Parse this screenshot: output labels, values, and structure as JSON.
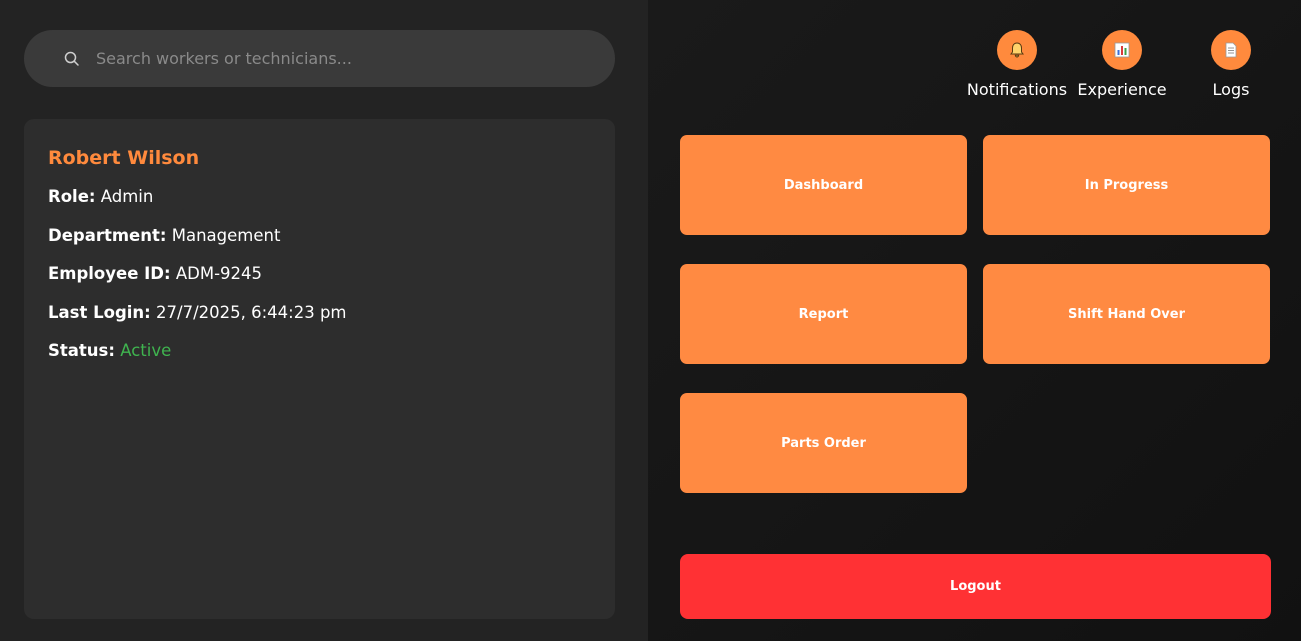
{
  "search": {
    "placeholder": "Search workers or technicians..."
  },
  "profile": {
    "name": "Robert Wilson",
    "fields": [
      {
        "key": "Role:",
        "value": "Admin"
      },
      {
        "key": "Department:",
        "value": "Management"
      },
      {
        "key": "Employee ID:",
        "value": "ADM-9245"
      },
      {
        "key": "Last Login:",
        "value": "27/7/2025, 6:44:23 pm"
      },
      {
        "key": "Status:",
        "value": "Active"
      }
    ]
  },
  "top_actions": [
    {
      "label": "Notifications",
      "icon": "bell-icon"
    },
    {
      "label": "Experience",
      "icon": "bar-chart-icon"
    },
    {
      "label": "Logs",
      "icon": "document-icon"
    }
  ],
  "tiles": [
    {
      "label": "Dashboard"
    },
    {
      "label": "In Progress"
    },
    {
      "label": "Report"
    },
    {
      "label": "Shift Hand Over"
    },
    {
      "label": "Parts Order"
    }
  ],
  "logout": {
    "label": "Logout"
  },
  "colors": {
    "accent": "#ff8a42",
    "logout": "#ff3134",
    "status_active": "#3fb44f"
  }
}
